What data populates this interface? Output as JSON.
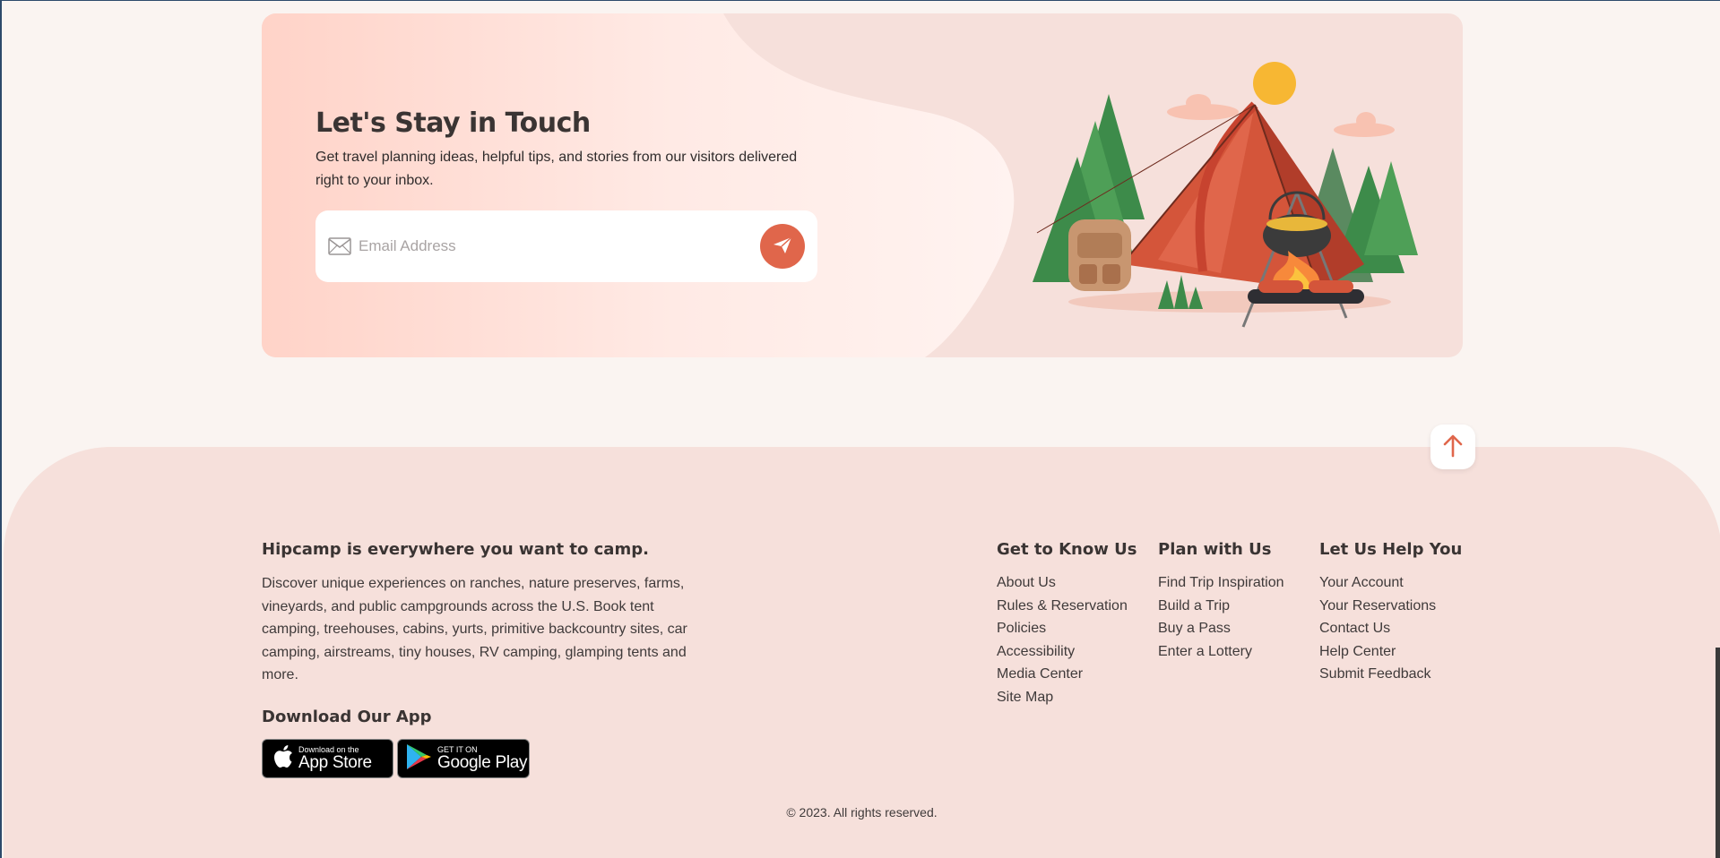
{
  "newsletter": {
    "title": "Let's Stay in Touch",
    "subtitle": "Get travel planning ideas, helpful tips, and stories from our visitors delivered right to your inbox.",
    "email_placeholder": "Email Address"
  },
  "footer": {
    "about_title": "Hipcamp is everywhere you want to camp.",
    "about_text": "Discover unique experiences on ranches, nature preserves, farms, vineyards, and public campgrounds across the U.S. Book tent camping, treehouses, cabins, yurts, primitive backcountry sites, car camping, airstreams, tiny houses, RV camping, glamping tents and more.",
    "app_title": "Download Our App",
    "app_store": {
      "small": "Download on the",
      "big": "App Store"
    },
    "google_play": {
      "small": "GET IT ON",
      "big": "Google Play"
    },
    "columns": [
      {
        "title": "Get to Know Us",
        "links": [
          "About Us",
          "Rules & Reservation",
          "Policies",
          "Accessibility",
          "Media Center",
          "Site Map"
        ]
      },
      {
        "title": "Plan with Us",
        "links": [
          "Find Trip Inspiration",
          "Build a Trip",
          "Buy a Pass",
          "Enter a Lottery"
        ]
      },
      {
        "title": "Let Us Help You",
        "links": [
          "Your Account",
          "Your Reservations",
          "Contact Us",
          "Help Center",
          "Submit Feedback"
        ]
      }
    ],
    "copyright": "© 2023. All rights reserved."
  },
  "colors": {
    "accent": "#e0664b",
    "background": "#faf4f1",
    "panel": "#f6e0db"
  },
  "icons": [
    "mail-icon",
    "paper-plane-icon",
    "arrow-up-icon",
    "apple-icon",
    "google-play-icon"
  ]
}
